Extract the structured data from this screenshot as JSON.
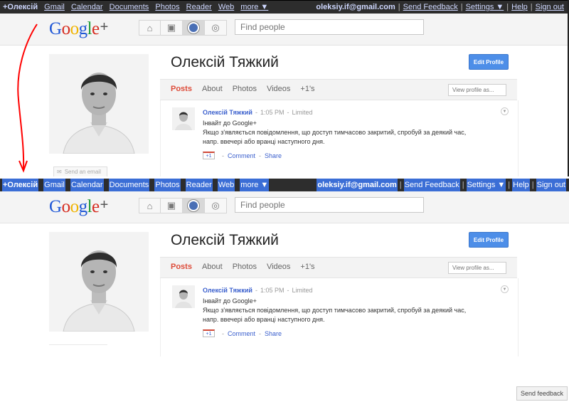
{
  "gbar": {
    "left_items": [
      "+Олексій",
      "Gmail",
      "Calendar",
      "Documents",
      "Photos",
      "Reader",
      "Web",
      "more ▼"
    ],
    "email": "oleksiy.if@gmail.com",
    "right_items": [
      "Send Feedback",
      "Settings ▼",
      "Help",
      "Sign out"
    ]
  },
  "logo": {
    "text": "Google",
    "plus": "+"
  },
  "nav_icons": [
    "home-icon",
    "photos-icon",
    "profile-icon",
    "circles-icon"
  ],
  "search": {
    "placeholder": "Find people"
  },
  "profile": {
    "name": "Олексій Тяжкий",
    "edit_button": "Edit Profile",
    "send_email": "Send an email"
  },
  "tabs": [
    "Posts",
    "About",
    "Photos",
    "Videos",
    "+1's"
  ],
  "active_tab": "Posts",
  "view_profile_as": "View profile as...",
  "post": {
    "author": "Олексій Тяжкий",
    "time": "1:05 PM",
    "visibility": "Limited",
    "line1": "Інвайт до Google+",
    "line2": "Якщо з'являється повідомлення, що доступ тимчасово закритий, спробуй за деякий час,",
    "line3": "напр. ввечері або вранці наступного дня.",
    "plus_one": "+1",
    "comment": "Comment",
    "share": "Share",
    "sep": "-",
    "dot": "·"
  },
  "send_feedback_tab": "Send feedback",
  "colors": {
    "gbar_bg": "#2d2d2d",
    "accent_blue": "#4d8ee8",
    "link_blue": "#3a5fcd",
    "active_tab": "#dd4b39",
    "annotation_arrow": "#ff0000",
    "selection": "#3b6ed6"
  }
}
